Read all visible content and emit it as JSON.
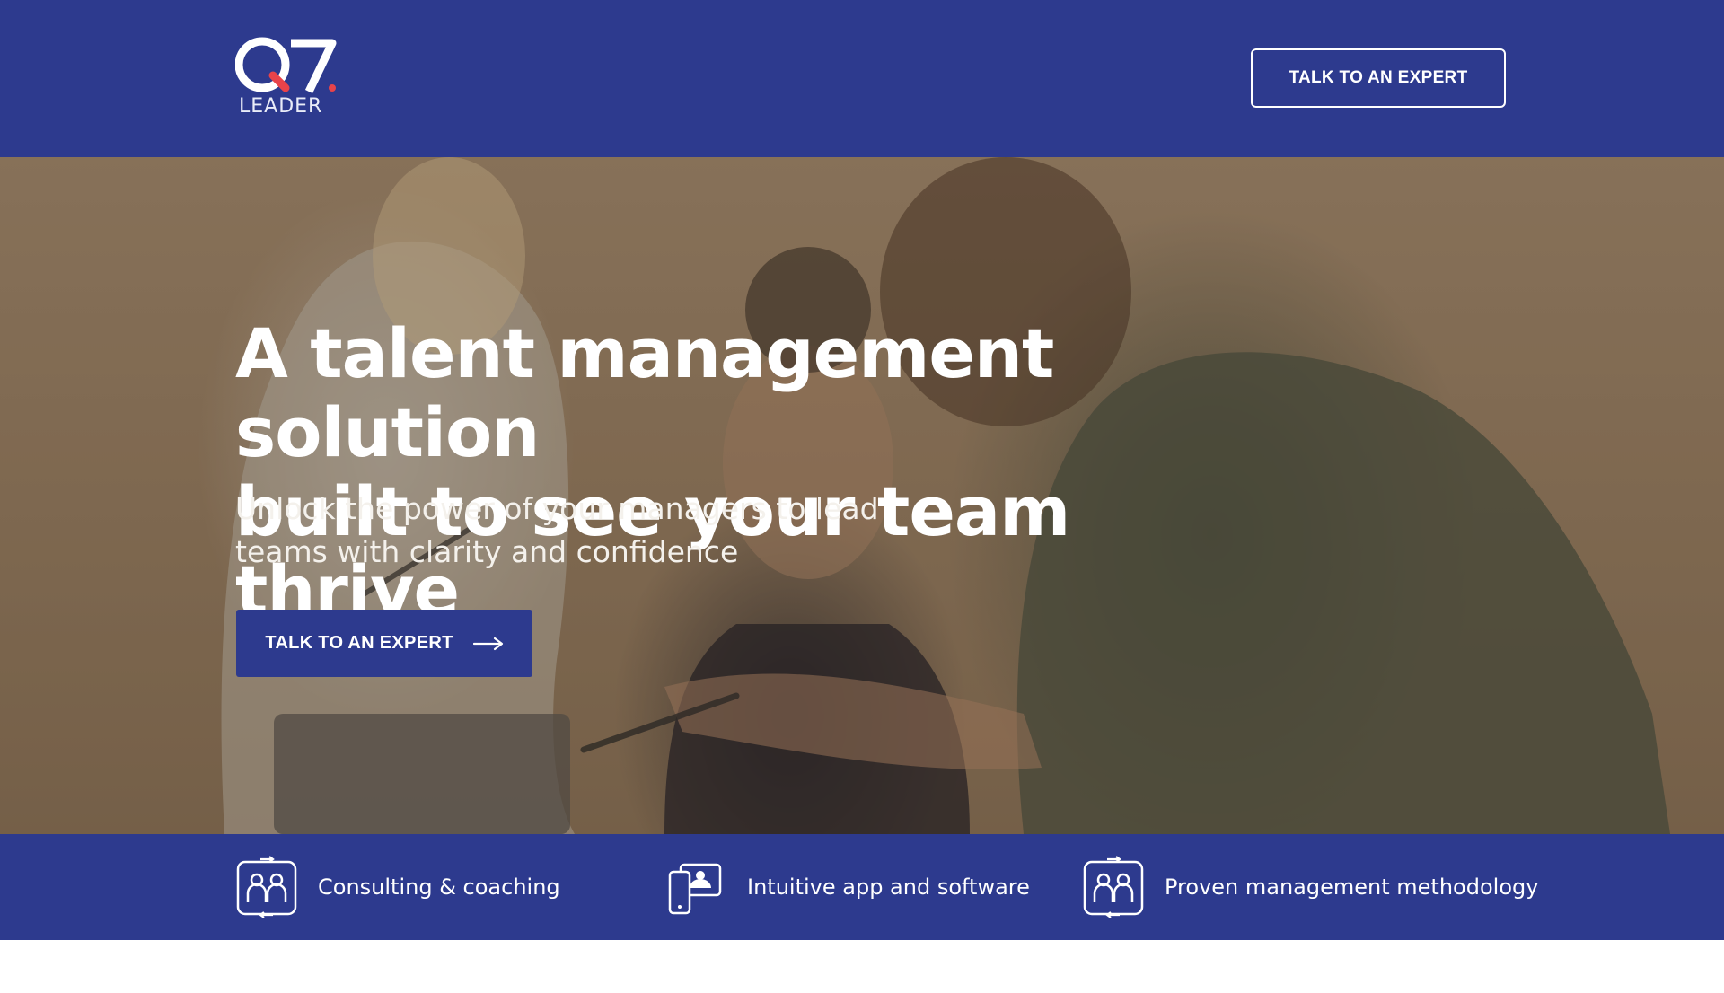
{
  "header": {
    "logo": {
      "mark": "Q7",
      "wordmark": "LEADER"
    },
    "cta_label": "TALK TO AN EXPERT"
  },
  "hero": {
    "title_line1": "A talent management solution",
    "title_line2": "built to see your team thrive",
    "subtitle_line1": "Unlock the power of your managers to lead",
    "subtitle_line2": "teams with clarity and confidence",
    "cta_label": "TALK TO AN EXPERT",
    "cta_icon": "arrow-right-icon"
  },
  "features": [
    {
      "label": "Consulting & coaching",
      "icon": "people-exchange-icon"
    },
    {
      "label": "Intuitive app and software",
      "icon": "device-screen-icon"
    },
    {
      "label": "Proven management methodology",
      "icon": "people-exchange-icon"
    }
  ],
  "colors": {
    "brand_blue": "#2d3a8e",
    "logo_accent": "#e8434a",
    "text_white": "#ffffff"
  }
}
